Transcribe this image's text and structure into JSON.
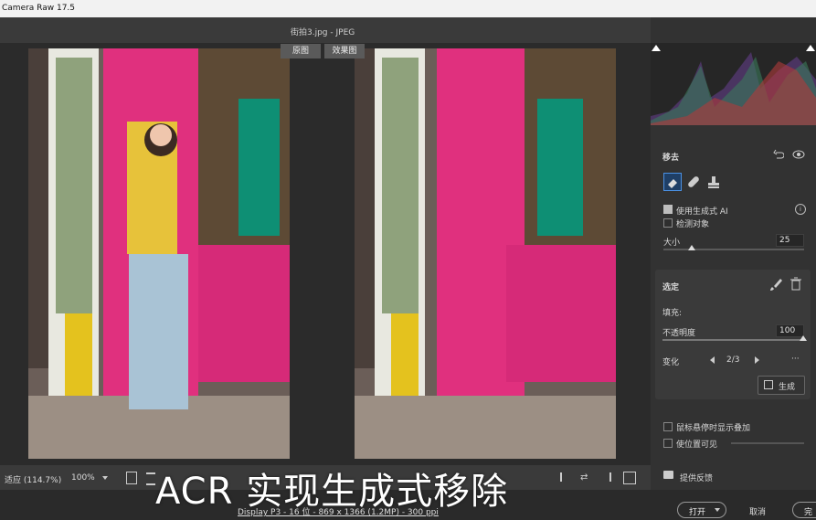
{
  "app": {
    "title": "Camera Raw 17.5"
  },
  "file": {
    "name": "街拍3.jpg  -  JPEG"
  },
  "view_tabs": {
    "before": "原图",
    "after": "效果图"
  },
  "remove_panel": {
    "title": "移去",
    "use_generative_ai": "使用生成式 AI",
    "detect_objects": "检测对象",
    "size_label": "大小",
    "size_value": "25",
    "size_level": 0.2
  },
  "selection_panel": {
    "title": "选定",
    "fill_label": "填充:",
    "opacity_label": "不透明度",
    "opacity_value": "100",
    "opacity_level": 1.0,
    "variation_label": "变化",
    "variation_value": "2/3",
    "more": "···",
    "generate_label": "生成"
  },
  "overlay_options": {
    "show_overlay_on_hover": "鼠标悬停时显示叠加",
    "make_position_visible": "使位置可见"
  },
  "feedback": {
    "label": "提供反馈"
  },
  "zoom": {
    "fit": "适应 (114.7%)",
    "percent": "100%"
  },
  "status_info": "Display P3 - 16 位 - 869 x 1366 (1.2MP) - 300 ppi",
  "actions": {
    "open": "打开",
    "cancel": "取消",
    "done": "完"
  },
  "caption": "ACR 实现生成式移除",
  "colors": {
    "accent_pink": "#e0307e",
    "panel": "#323232",
    "door_yellow": "#e4c21e"
  }
}
